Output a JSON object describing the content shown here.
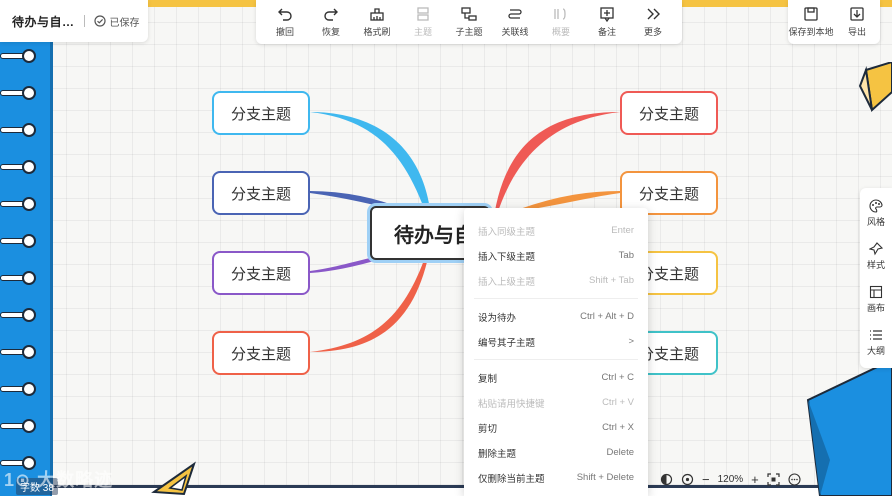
{
  "document": {
    "title": "待办与自…",
    "saved_status": "已保存"
  },
  "toolbar": {
    "items": [
      {
        "label": "撤回",
        "icon": "undo-icon",
        "enabled": true
      },
      {
        "label": "恢复",
        "icon": "redo-icon",
        "enabled": true
      },
      {
        "label": "格式刷",
        "icon": "format-brush-icon",
        "enabled": true
      },
      {
        "label": "主题",
        "icon": "topic-icon",
        "enabled": false
      },
      {
        "label": "子主题",
        "icon": "subtopic-icon",
        "enabled": true
      },
      {
        "label": "关联线",
        "icon": "relation-line-icon",
        "enabled": true
      },
      {
        "label": "概要",
        "icon": "summary-icon",
        "enabled": false
      },
      {
        "label": "备注",
        "icon": "note-icon",
        "enabled": true
      },
      {
        "label": "更多",
        "icon": "more-icon",
        "enabled": true
      }
    ]
  },
  "right_tools": {
    "save_local": "保存到本地",
    "export": "导出"
  },
  "side_panel": {
    "items": [
      {
        "label": "风格",
        "icon": "palette-icon"
      },
      {
        "label": "样式",
        "icon": "style-icon"
      },
      {
        "label": "画布",
        "icon": "canvas-icon"
      },
      {
        "label": "大纲",
        "icon": "outline-icon"
      }
    ]
  },
  "mindmap": {
    "root": "待办与自",
    "left_branches": [
      {
        "label": "分支主题",
        "color": "#3fb8ef"
      },
      {
        "label": "分支主题",
        "color": "#4a64b4"
      },
      {
        "label": "分支主题",
        "color": "#8a58c8"
      },
      {
        "label": "分支主题",
        "color": "#ef6148"
      }
    ],
    "right_branches": [
      {
        "label": "分支主题",
        "color": "#ef5a55"
      },
      {
        "label": "分支主题",
        "color": "#f3943e"
      },
      {
        "label": "分支主题",
        "color": "#f5c342"
      },
      {
        "label": "分支主题",
        "color": "#3fc2c8"
      }
    ]
  },
  "context_menu": {
    "items": [
      {
        "label": "插入同级主题",
        "shortcut": "Enter",
        "enabled": false
      },
      {
        "label": "插入下级主题",
        "shortcut": "Tab",
        "enabled": true
      },
      {
        "label": "插入上级主题",
        "shortcut": "Shift + Tab",
        "enabled": false
      },
      {
        "divider": true
      },
      {
        "label": "设为待办",
        "shortcut": "Ctrl + Alt + D",
        "enabled": true
      },
      {
        "label": "编号其子主题",
        "shortcut": ">",
        "enabled": true
      },
      {
        "divider": true
      },
      {
        "label": "复制",
        "shortcut": "Ctrl + C",
        "enabled": true
      },
      {
        "label": "粘贴请用快捷键",
        "shortcut": "Ctrl + V",
        "enabled": false
      },
      {
        "label": "剪切",
        "shortcut": "Ctrl + X",
        "enabled": true
      },
      {
        "label": "删除主题",
        "shortcut": "Delete",
        "enabled": true
      },
      {
        "label": "仅删除当前主题",
        "shortcut": "Shift + Delete",
        "enabled": true
      }
    ]
  },
  "zoom": {
    "level": "120%"
  },
  "status": {
    "text": "字数 38"
  },
  "watermark": "1⊙ 大数略迹"
}
